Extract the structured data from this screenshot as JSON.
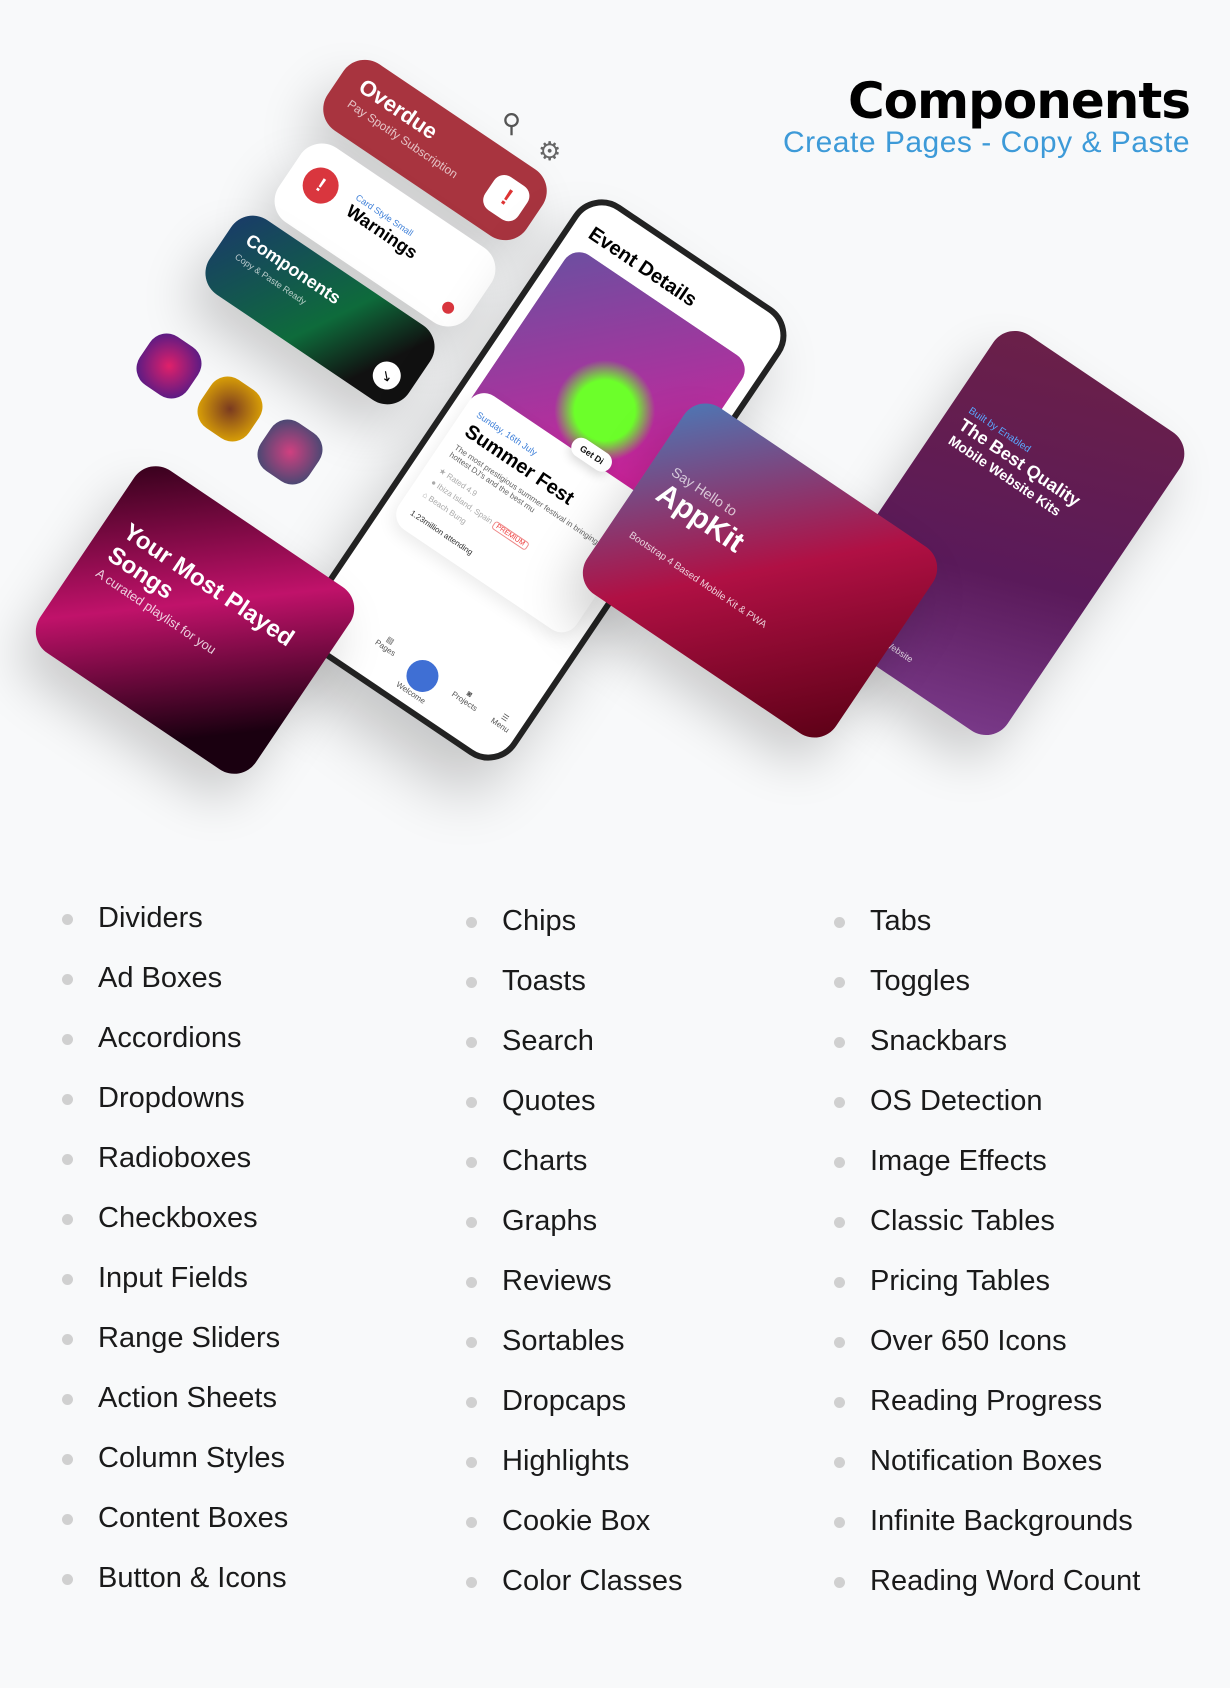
{
  "header": {
    "title": "Components",
    "subtitle": "Create Pages - Copy & Paste"
  },
  "hero": {
    "overdue": {
      "title": "Overdue",
      "subtitle": "Pay Spotify Subscription"
    },
    "warning": {
      "label": "Card Style Small",
      "title": "Warnings"
    },
    "components_card": {
      "title": "Components",
      "subtitle": "Copy & Paste Ready"
    },
    "phone": {
      "header": "Event Details",
      "date": "Sunday, 16th July",
      "event": "Summer Fest",
      "description": "The most prestigious summer festival in bringing the hottest DJ's and the best mu",
      "rating": "Rated 4.9",
      "location": "Ibiza Island, Spain",
      "venue": "Beach Bung",
      "badge": "PREMIUM",
      "attending": "1.23million attending",
      "button": "Get Di",
      "nav": [
        "Pages",
        "Welcome",
        "Projects",
        "Menu"
      ]
    },
    "playlist": {
      "title": "Your Most Played Songs",
      "subtitle": "A curated playlist for you"
    },
    "appkit": {
      "pre": "Say Hello to",
      "title": "AppKit",
      "caption": "Bootstrap 4 Based Mobile Kit & PWA"
    },
    "kit": {
      "label": "Built by Enabled",
      "title": "The Best Quality",
      "subtitle": "Mobile Website Kits",
      "footer": "Perfect Mobile Website"
    }
  },
  "features": [
    [
      "Dividers",
      "Ad Boxes",
      "Accordions",
      "Dropdowns",
      "Radioboxes",
      "Checkboxes",
      "Input Fields",
      "Range Sliders",
      "Action Sheets",
      "Column Styles",
      "Content Boxes",
      "Button & Icons"
    ],
    [
      "Chips",
      "Toasts",
      "Search",
      "Quotes",
      "Charts",
      "Graphs",
      "Reviews",
      "Sortables",
      "Dropcaps",
      "Highlights",
      "Cookie Box",
      "Color Classes"
    ],
    [
      "Tabs",
      "Toggles",
      "Snackbars",
      "OS Detection",
      "Image Effects",
      "Classic Tables",
      "Pricing Tables",
      "Over 650 Icons",
      "Reading Progress",
      "Notification Boxes",
      "Infinite Backgrounds",
      "Reading Word Count"
    ]
  ],
  "colors": {
    "accent": "#3d9ad8",
    "danger": "#a8343f"
  }
}
